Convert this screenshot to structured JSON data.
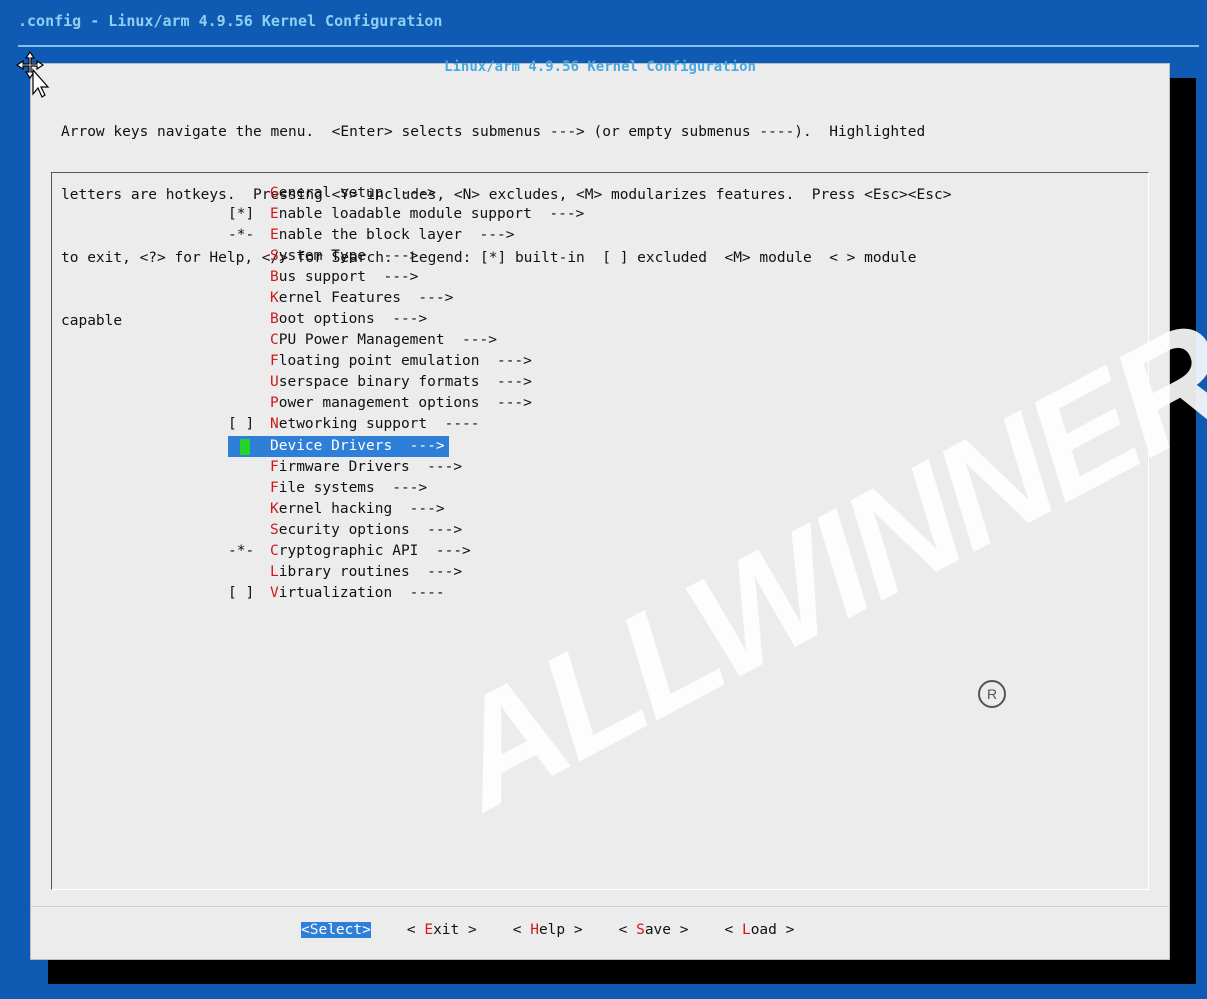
{
  "window": {
    "title": ".config - Linux/arm 4.9.56 Kernel Configuration"
  },
  "dialog": {
    "title": "Linux/arm 4.9.56 Kernel Configuration",
    "help_lines": [
      "Arrow keys navigate the menu.  <Enter> selects submenus ---> (or empty submenus ----).  Highlighted",
      "letters are hotkeys.  Pressing <Y> includes, <N> excludes, <M> modularizes features.  Press <Esc><Esc>",
      "to exit, <?> for Help, </> for Search.  Legend: [*] built-in  [ ] excluded  <M> module  < > module",
      "capable"
    ]
  },
  "menu": [
    {
      "prefix": "",
      "hotkey": "G",
      "rest": "eneral setup  --->"
    },
    {
      "prefix": "[*]",
      "hotkey": "E",
      "rest": "nable loadable module support  --->"
    },
    {
      "prefix": "-*-",
      "hotkey": "E",
      "rest": "nable the block layer  --->"
    },
    {
      "prefix": "",
      "hotkey": "S",
      "rest": "ystem Type  --->"
    },
    {
      "prefix": "",
      "hotkey": "B",
      "rest": "us support  --->"
    },
    {
      "prefix": "",
      "hotkey": "K",
      "rest": "ernel Features  --->"
    },
    {
      "prefix": "",
      "hotkey": "B",
      "rest": "oot options  --->"
    },
    {
      "prefix": "",
      "hotkey": "C",
      "rest": "PU Power Management  --->"
    },
    {
      "prefix": "",
      "hotkey": "F",
      "rest": "loating point emulation  --->"
    },
    {
      "prefix": "",
      "hotkey": "U",
      "rest": "serspace binary formats  --->"
    },
    {
      "prefix": "",
      "hotkey": "P",
      "rest": "ower management options  --->"
    },
    {
      "prefix": "[ ]",
      "hotkey": "N",
      "rest": "etworking support  ----"
    },
    {
      "prefix": "",
      "hotkey": "D",
      "rest": "evice Drivers  --->",
      "selected": true
    },
    {
      "prefix": "",
      "hotkey": "F",
      "rest": "irmware Drivers  --->"
    },
    {
      "prefix": "",
      "hotkey": "F",
      "rest": "ile systems  --->"
    },
    {
      "prefix": "",
      "hotkey": "K",
      "rest": "ernel hacking  --->"
    },
    {
      "prefix": "",
      "hotkey": "S",
      "rest": "ecurity options  --->"
    },
    {
      "prefix": "-*-",
      "hotkey": "C",
      "rest": "ryptographic API  --->"
    },
    {
      "prefix": "",
      "hotkey": "L",
      "rest": "ibrary routines  --->"
    },
    {
      "prefix": "[ ]",
      "hotkey": "V",
      "rest": "irtualization  ----"
    }
  ],
  "buttons": [
    {
      "left": "<",
      "hotkey": "S",
      "rest": "elect",
      "right": ">",
      "selected": true
    },
    {
      "left": "< ",
      "hotkey": "E",
      "rest": "xit",
      "right": " >"
    },
    {
      "left": "< ",
      "hotkey": "H",
      "rest": "elp",
      "right": " >"
    },
    {
      "left": "< ",
      "hotkey": "S",
      "rest": "ave",
      "right": " >"
    },
    {
      "left": "< ",
      "hotkey": "L",
      "rest": "oad",
      "right": " >"
    }
  ],
  "watermark": {
    "text": "ALLWINNER",
    "mark": "R"
  },
  "colors": {
    "background": "#0f5bb4",
    "dialog": "#ececec",
    "highlight": "#2e7fd8",
    "hotkey": "#d01818",
    "cursor": "#27d32a"
  }
}
